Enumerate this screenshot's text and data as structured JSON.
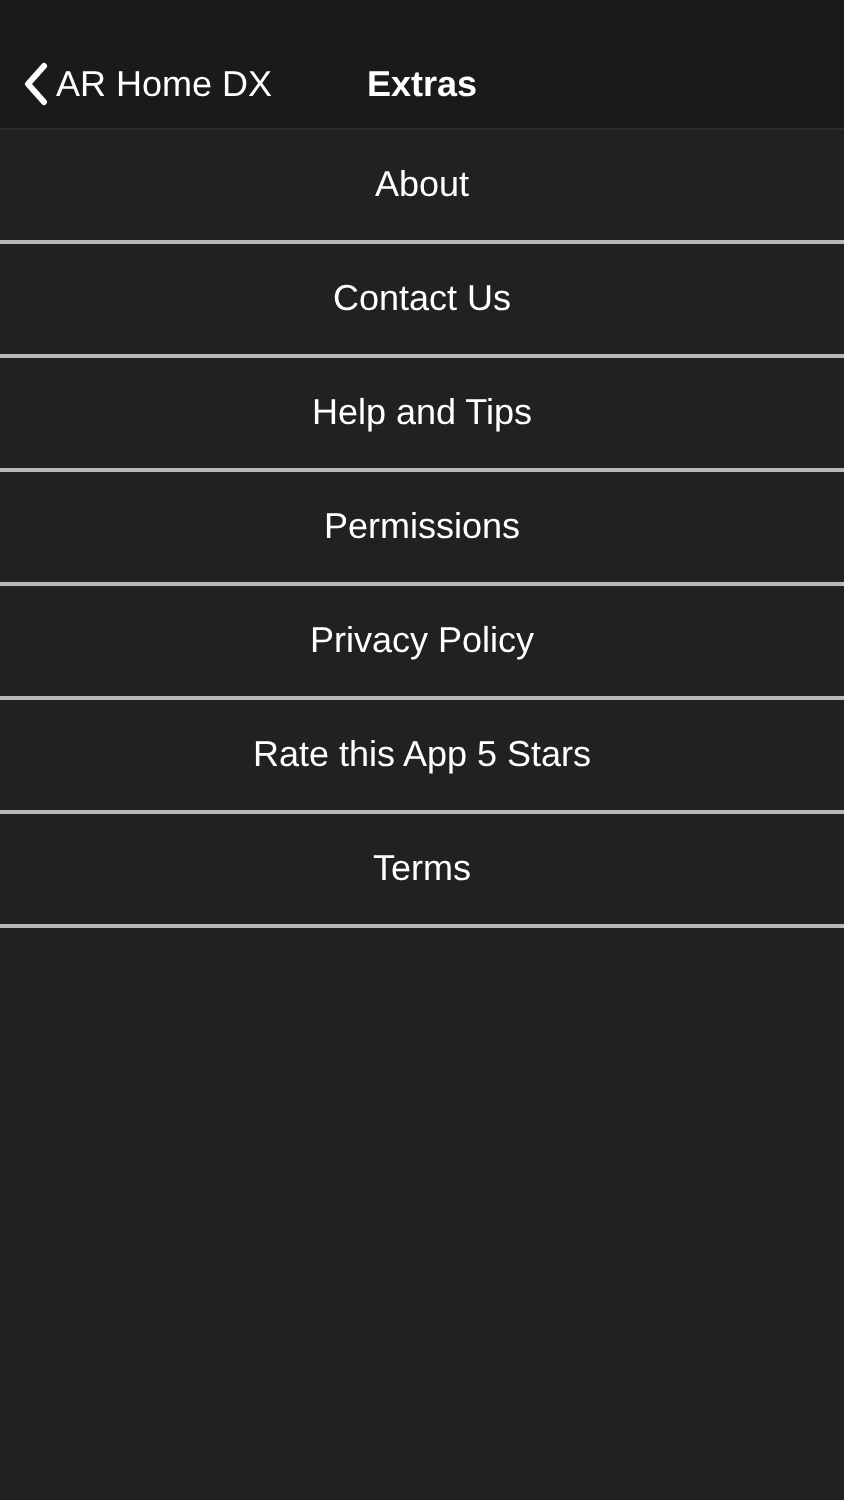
{
  "nav_bar": {
    "back_label": "AR Home DX",
    "title": "Extras"
  },
  "menu_items": [
    "About",
    "Contact Us",
    "Help and Tips",
    "Permissions",
    "Privacy Policy",
    "Rate this App 5 Stars",
    "Terms"
  ]
}
